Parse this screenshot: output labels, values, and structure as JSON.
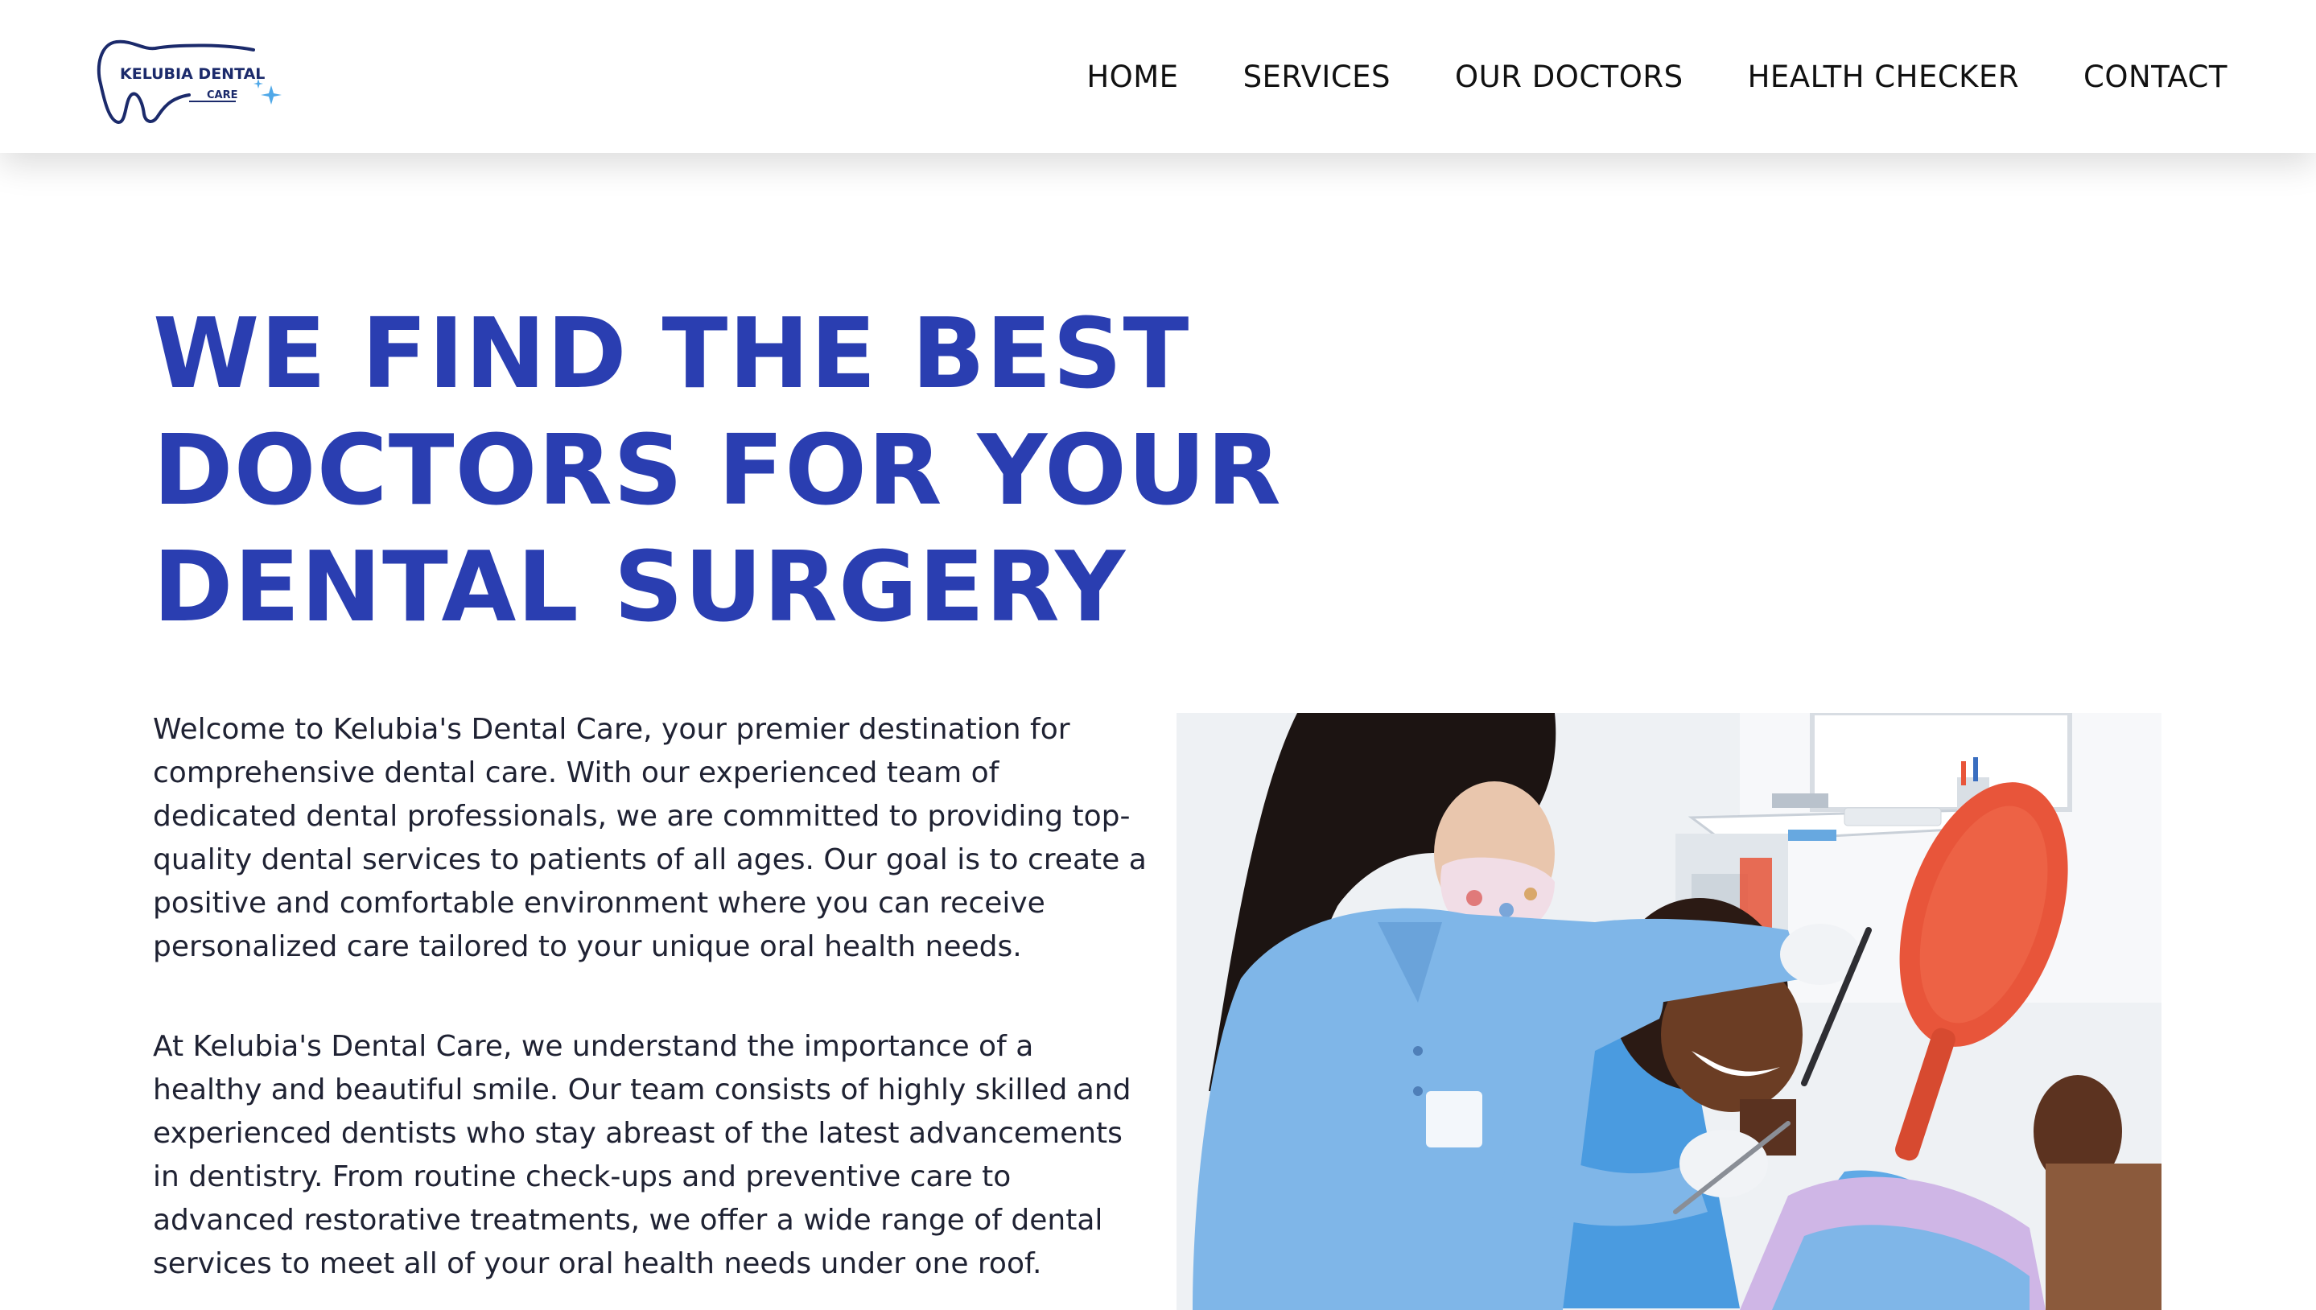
{
  "header": {
    "logo": {
      "line1": "KELUBIA DENTAL",
      "line2": "CARE"
    },
    "nav": [
      {
        "label": "HOME"
      },
      {
        "label": "SERVICES"
      },
      {
        "label": "OUR DOCTORS"
      },
      {
        "label": "HEALTH CHECKER"
      },
      {
        "label": "CONTACT"
      }
    ]
  },
  "hero": {
    "title": "We Find the Best Doctors for your dental surgery",
    "paragraphs": [
      "Welcome to Kelubia's Dental Care, your premier destination for comprehensive dental care. With our experienced team of dedicated dental professionals, we are committed to providing top-quality dental services to patients of all ages. Our goal is to create a positive and comfortable environment where you can receive personalized care tailored to your unique oral health needs.",
      "At Kelubia's Dental Care, we understand the importance of a healthy and beautiful smile. Our team consists of highly skilled and experienced dentists who stay abreast of the latest advancements in dentistry. From routine check-ups and preventive care to advanced restorative treatments, we offer a wide range of dental services to meet all of your oral health needs under one roof."
    ]
  },
  "colors": {
    "accent": "#2a3eb1",
    "logo_navy": "#1b2a6b",
    "scrub_blue": "#7fb6e8",
    "mirror_orange": "#e8553a"
  }
}
